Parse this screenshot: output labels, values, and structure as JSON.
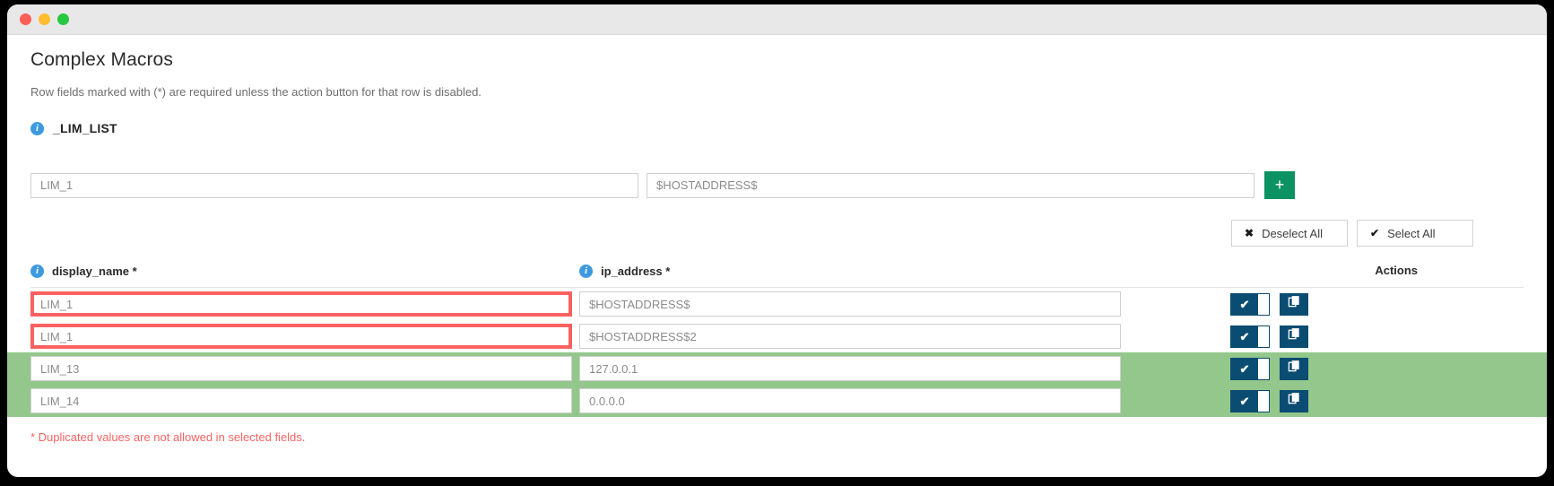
{
  "window": {
    "traffic_lights": [
      "close",
      "minimize",
      "maximize"
    ]
  },
  "header": {
    "title": "Complex Macros",
    "subtitle": "Row fields marked with (*) are required unless the action button for that row is disabled."
  },
  "group": {
    "info_icon": "info-icon",
    "name": "_LIM_LIST"
  },
  "new_entry": {
    "name_value": "LIM_1",
    "ip_value": "$HOSTADDRESS$",
    "add_label": "+"
  },
  "select_bar": {
    "deselect_icon": "✖",
    "deselect_label": "Deselect All",
    "select_icon": "✔",
    "select_label": "Select All"
  },
  "table": {
    "columns": [
      {
        "label": "display_name *",
        "info_icon": "info-icon"
      },
      {
        "label": "ip_address *",
        "info_icon": "info-icon"
      }
    ],
    "actions_label": "Actions",
    "rows": [
      {
        "display_name": "LIM_1",
        "ip_address": "$HOSTADDRESS$",
        "name_error": true,
        "selected": false,
        "toggle_icon": "✔",
        "copy_icon": "copy-icon"
      },
      {
        "display_name": "LIM_1",
        "ip_address": "$HOSTADDRESS$2",
        "name_error": true,
        "selected": false,
        "toggle_icon": "✔",
        "copy_icon": "copy-icon"
      },
      {
        "display_name": "LIM_13",
        "ip_address": "127.0.0.1",
        "name_error": false,
        "selected": true,
        "toggle_icon": "✔",
        "copy_icon": "copy-icon"
      },
      {
        "display_name": "LIM_14",
        "ip_address": "0.0.0.0",
        "name_error": false,
        "selected": true,
        "toggle_icon": "✔",
        "copy_icon": "copy-icon"
      }
    ]
  },
  "footer": {
    "error_message": "* Duplicated values are not allowed in selected fields."
  },
  "colors": {
    "accent_green": "#0d9263",
    "row_selected": "#93c78b",
    "error_red": "#fc6161",
    "error_text": "#fa6464",
    "action_navy": "#0b4c72",
    "info_blue": "#3d9ae0"
  }
}
